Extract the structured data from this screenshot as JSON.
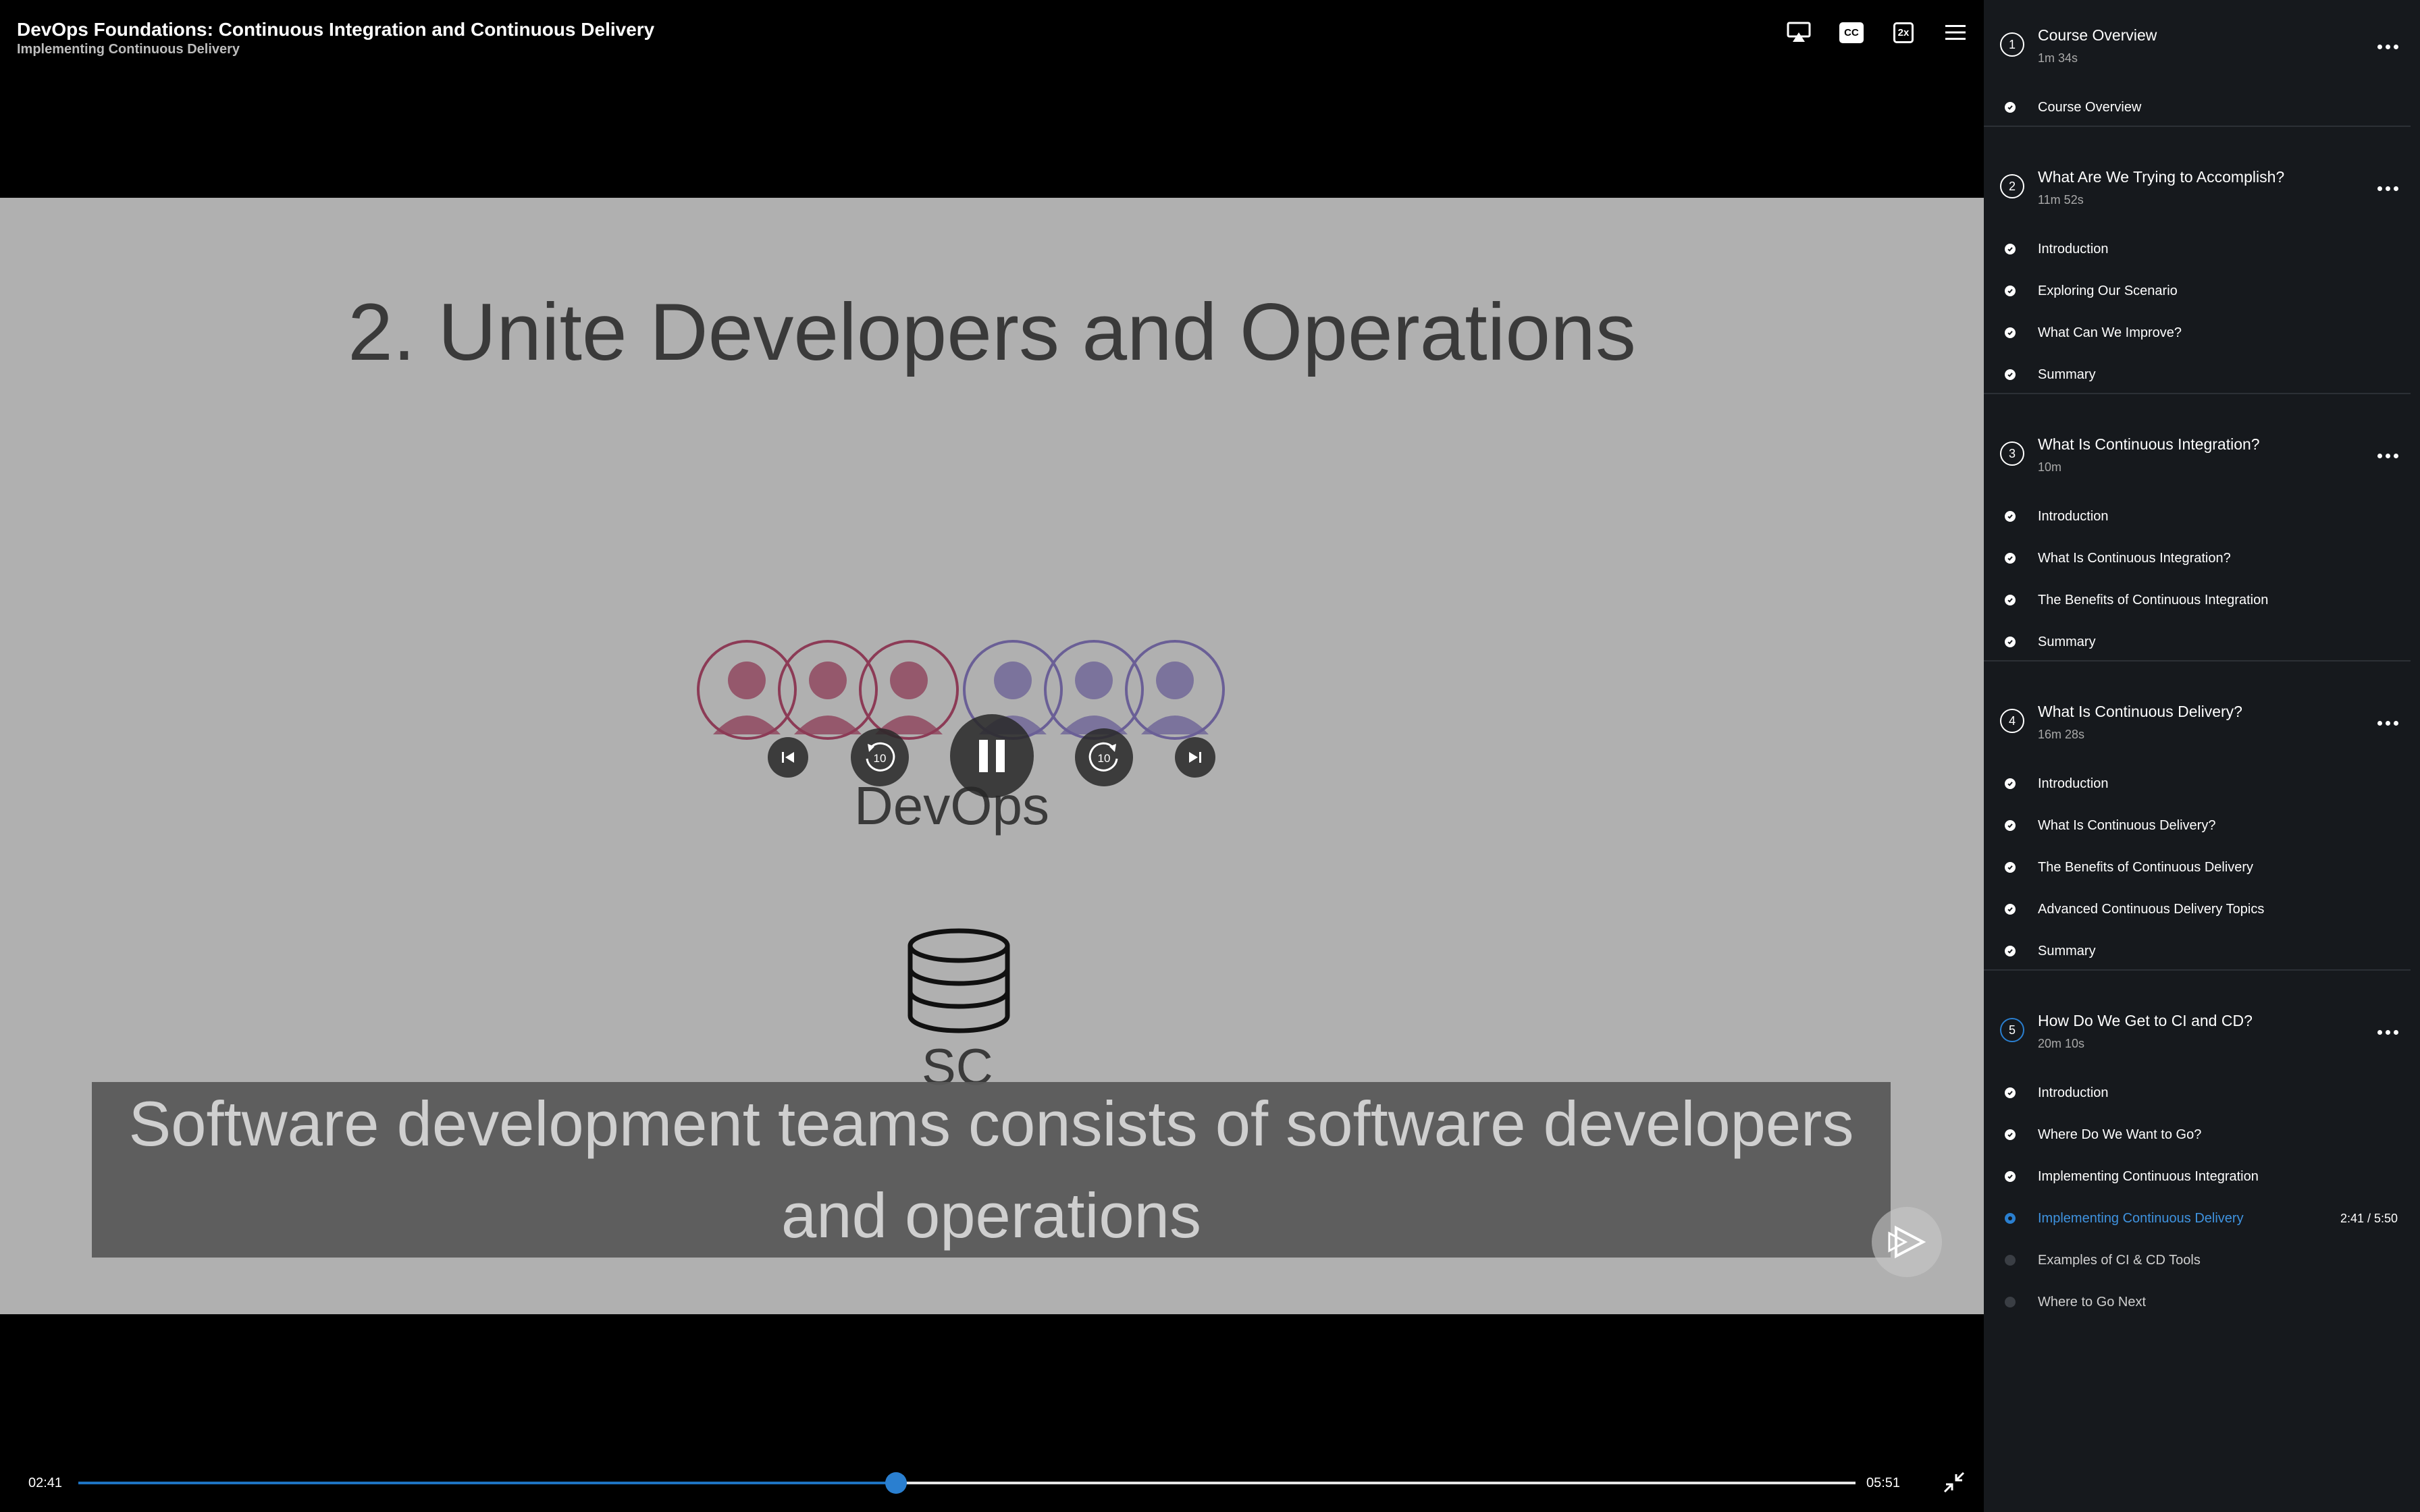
{
  "header": {
    "course_title": "DevOps Foundations: Continuous Integration and Continuous Delivery",
    "module_subtitle": "Implementing Continuous Delivery",
    "icons": [
      "airplay-icon",
      "closed-captions-icon",
      "playback-speed-icon",
      "menu-icon"
    ],
    "cc_label": "CC",
    "speed_label": "2x"
  },
  "slide": {
    "heading": "2. Unite Developers and Operations",
    "devops_label": "DevOps",
    "sc_label": "SC",
    "colors": {
      "dev": "#8c3b56",
      "ops": "#6a5f96",
      "background": "#b0b0b0"
    }
  },
  "caption": {
    "text": "Software development teams consists of software developers and operations"
  },
  "controls": {
    "skip_back_seconds": "10",
    "skip_forward_seconds": "10",
    "state": "playing"
  },
  "playback": {
    "current_time": "02:41",
    "total_time": "05:51",
    "progress_fraction": 0.46,
    "accent_color": "#2a7fd0"
  },
  "sidebar": {
    "modules": [
      {
        "number": "1",
        "title": "Course Overview",
        "duration": "1m 34s",
        "clips": [
          {
            "label": "Course Overview",
            "status": "done"
          }
        ]
      },
      {
        "number": "2",
        "title": "What Are We Trying to Accomplish?",
        "duration": "11m 52s",
        "clips": [
          {
            "label": "Introduction",
            "status": "done"
          },
          {
            "label": "Exploring Our Scenario",
            "status": "done"
          },
          {
            "label": "What Can We Improve?",
            "status": "done"
          },
          {
            "label": "Summary",
            "status": "done"
          }
        ]
      },
      {
        "number": "3",
        "title": "What Is Continuous Integration?",
        "duration": "10m",
        "clips": [
          {
            "label": "Introduction",
            "status": "done"
          },
          {
            "label": "What Is Continuous Integration?",
            "status": "done"
          },
          {
            "label": "The Benefits of Continuous Integration",
            "status": "done"
          },
          {
            "label": "Summary",
            "status": "done"
          }
        ]
      },
      {
        "number": "4",
        "title": "What Is Continuous Delivery?",
        "duration": "16m 28s",
        "clips": [
          {
            "label": "Introduction",
            "status": "done"
          },
          {
            "label": "What Is Continuous Delivery?",
            "status": "done"
          },
          {
            "label": "The Benefits of Continuous Delivery",
            "status": "done"
          },
          {
            "label": "Advanced Continuous Delivery Topics",
            "status": "done"
          },
          {
            "label": "Summary",
            "status": "done"
          }
        ]
      },
      {
        "number": "5",
        "title": "How Do We Get to CI and CD?",
        "duration": "20m 10s",
        "clips": [
          {
            "label": "Introduction",
            "status": "done"
          },
          {
            "label": "Where Do We Want to Go?",
            "status": "done"
          },
          {
            "label": "Implementing Continuous Integration",
            "status": "done"
          },
          {
            "label": "Implementing Continuous Delivery",
            "status": "active",
            "progress": "2:41 / 5:50"
          },
          {
            "label": "Examples of CI & CD Tools",
            "status": "pending"
          },
          {
            "label": "Where to Go Next",
            "status": "pending"
          }
        ]
      }
    ]
  }
}
